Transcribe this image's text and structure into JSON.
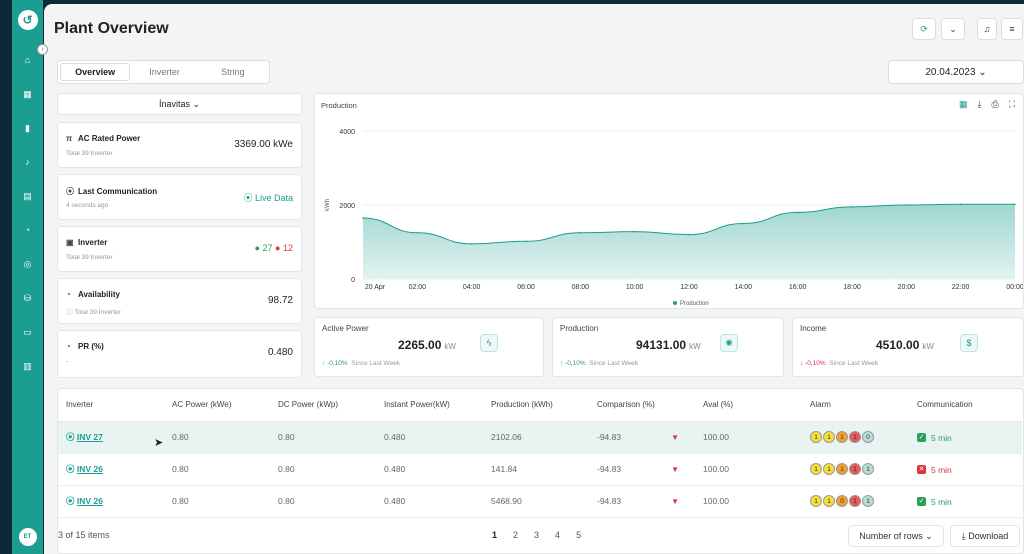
{
  "sidebar": {
    "avatar": "ET"
  },
  "header": {
    "title": "Plant Overview"
  },
  "tabs": [
    "Overview",
    "Inverter",
    "String"
  ],
  "date": "20.04.2023",
  "plant_selector": "İnavitas",
  "stats": [
    {
      "title": "AC Rated Power",
      "sub": "Total 39 Inverter",
      "value": "3369.00 kWe"
    },
    {
      "title": "Last Communication",
      "sub": "4 seconds ago",
      "value": "Live Data"
    },
    {
      "title": "Inverter",
      "sub": "Total 39 Inverter",
      "ok": "27",
      "bad": "12"
    },
    {
      "title": "Availability",
      "sub": "Total 39 Inverter",
      "value": "98.72"
    },
    {
      "title": "PR (%)",
      "sub": "-",
      "value": "0.480"
    }
  ],
  "chart_panel_title": "Production",
  "chart_data": {
    "type": "area",
    "ylabel": "kWh",
    "ylim": [
      0,
      4000
    ],
    "yticks": [
      0,
      2000,
      4000
    ],
    "x": [
      "20 Apr",
      "02:00",
      "04:00",
      "06:00",
      "08:00",
      "10:00",
      "12:00",
      "14:00",
      "16:00",
      "18:00",
      "20:00",
      "22:00",
      "00:00"
    ],
    "series": [
      {
        "name": "Production",
        "values": [
          1650,
          1250,
          950,
          1020,
          1250,
          1280,
          1200,
          1500,
          1800,
          1950,
          2000,
          2020,
          2020
        ]
      }
    ],
    "legend": "bottom"
  },
  "metrics": [
    {
      "title": "Active Power",
      "value": "2265.00",
      "unit": "kW",
      "delta": "-0,10%",
      "dir": "up",
      "since": "Since Last Week"
    },
    {
      "title": "Production",
      "value": "94131.00",
      "unit": "kW",
      "delta": "-0,10%",
      "dir": "up",
      "since": "Since Last Week"
    },
    {
      "title": "Income",
      "value": "4510.00",
      "unit": "kW",
      "delta": "-0,10%",
      "dir": "down",
      "since": "Since Last Week"
    }
  ],
  "table": {
    "headers": [
      "Inverter",
      "AC Power (kWe)",
      "DC Power (kWp)",
      "Instant Power(kW)",
      "Production (kWh)",
      "Comparison (%)",
      "Aval (%)",
      "Alarm",
      "Communication"
    ],
    "rows": [
      {
        "inv": "INV 27",
        "ac": "0.80",
        "dc": "0.80",
        "inst": "0.480",
        "prod": "2102.06",
        "cmp": "-94.83",
        "aval": "100.00",
        "alarms": [
          "1",
          "1",
          "1",
          "1",
          "0"
        ],
        "comm": "5 min",
        "ok": true
      },
      {
        "inv": "INV 26",
        "ac": "0.80",
        "dc": "0.80",
        "inst": "0.480",
        "prod": "141.84",
        "cmp": "-94.83",
        "aval": "100.00",
        "alarms": [
          "1",
          "1",
          "1",
          "1",
          "1"
        ],
        "comm": "5 min",
        "ok": false
      },
      {
        "inv": "INV 26",
        "ac": "0.80",
        "dc": "0.80",
        "inst": "0.480",
        "prod": "5468.90",
        "cmp": "-94.83",
        "aval": "100.00",
        "alarms": [
          "1",
          "1",
          "0",
          "1",
          "1"
        ],
        "comm": "5 min",
        "ok": true
      }
    ]
  },
  "footer": {
    "items": "3 of 15 items",
    "pages": [
      "1",
      "2",
      "3",
      "4",
      "5"
    ],
    "rows_label": "Number of rows",
    "download": "Download"
  },
  "colors": {
    "accent": "#1b9d8f",
    "alarm": [
      "#f5e03a",
      "#f5e03a",
      "#f0a030",
      "#e65a5a",
      "#b8dcd6"
    ]
  }
}
